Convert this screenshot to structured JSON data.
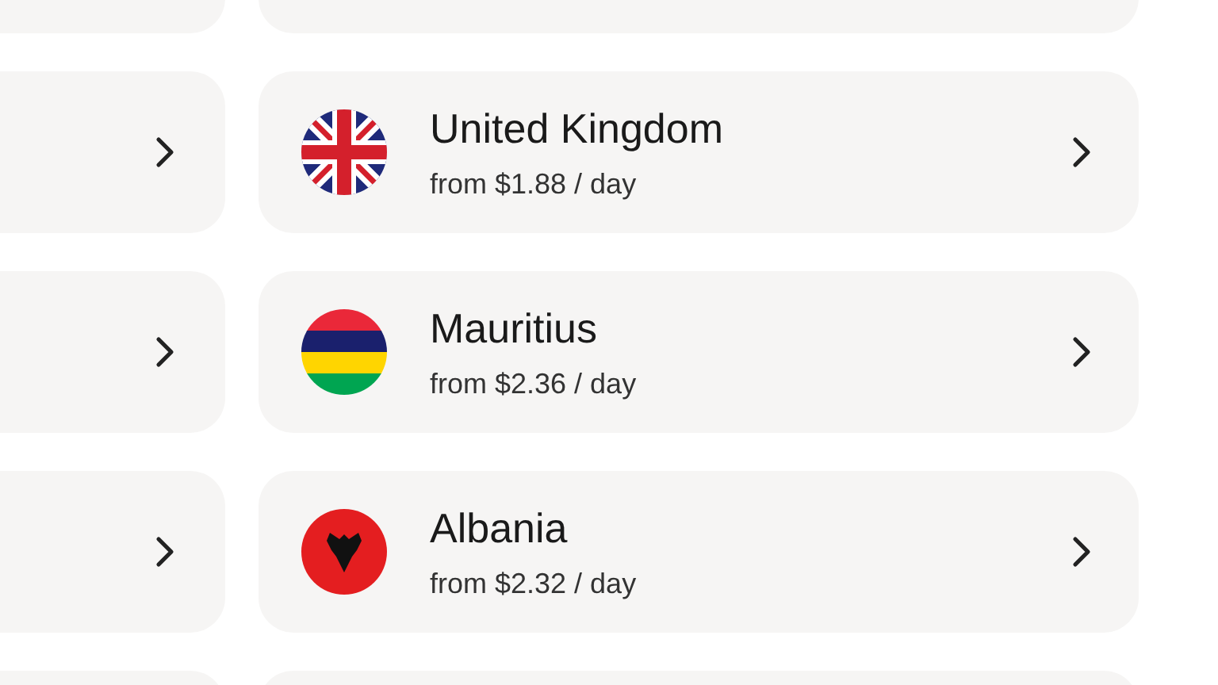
{
  "destinations": [
    {
      "kind": "blank"
    },
    {
      "kind": "uk",
      "name": "United Kingdom",
      "price": "from $1.88 / day"
    },
    {
      "kind": "mauritius",
      "name": "Mauritius",
      "price": "from $2.36 / day"
    },
    {
      "kind": "albania",
      "name": "Albania",
      "price": "from $2.32 / day"
    },
    {
      "kind": "blank"
    }
  ]
}
